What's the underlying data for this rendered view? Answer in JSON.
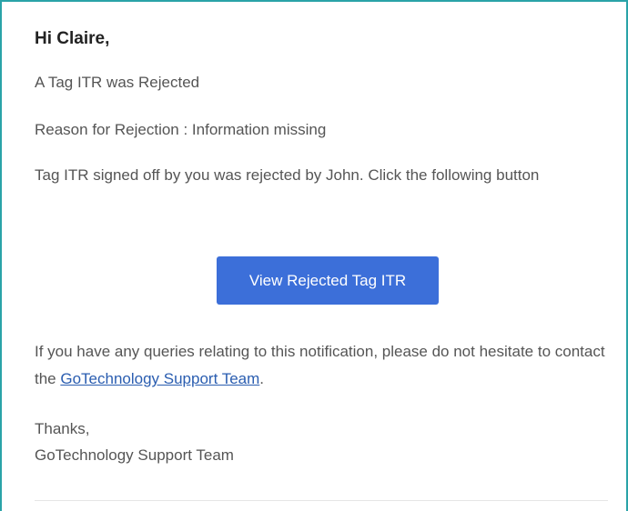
{
  "email": {
    "greeting": "Hi Claire,",
    "subject_line": "A Tag ITR was Rejected",
    "reason": "Reason for Rejection : Information missing",
    "body": "Tag ITR signed off by you was rejected by John. Click the following button",
    "cta_label": "View Rejected Tag ITR",
    "queries_text": "If you have any queries relating to this notification, please do not hesitate to contact the ",
    "support_link": "GoTechnology Support Team",
    "queries_end": ".",
    "sign_off": "Thanks,",
    "signature": "GoTechnology Support Team"
  },
  "colors": {
    "frame_border": "#2aa3a8",
    "button_bg": "#3c6fd9",
    "link": "#2a5db0",
    "text": "#555555",
    "heading": "#222222"
  }
}
